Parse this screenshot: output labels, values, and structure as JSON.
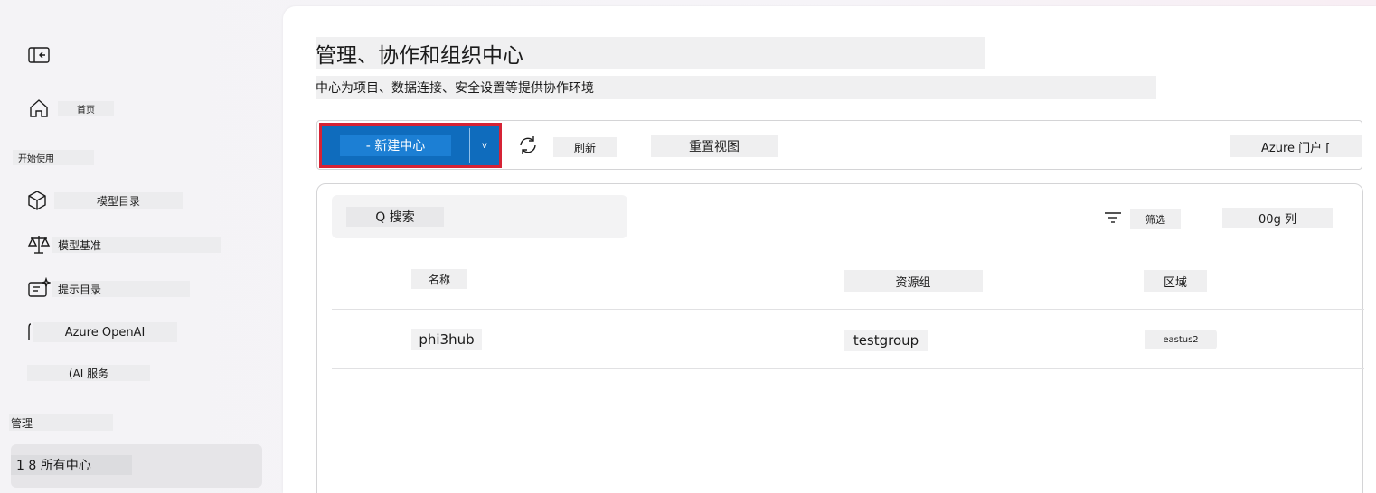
{
  "sidebar": {
    "items": [
      {
        "label": "首页",
        "icon": "home-icon"
      },
      {
        "label": "开始使用"
      },
      {
        "label": "模型目录",
        "icon": "cube-icon"
      },
      {
        "label": "模型基准",
        "icon": "scale-icon"
      },
      {
        "label": "提示目录",
        "icon": "prompt-catalog-icon"
      },
      {
        "label": "Azure OpenAI",
        "icon": "openai-icon"
      },
      {
        "label": "(AI 服务"
      }
    ],
    "section_manage": "管理",
    "active_item": "1 8 所有中心",
    "collapse_icon": "collapse-panel-icon"
  },
  "main": {
    "title": "管理、协作和组织中心",
    "subtitle": "中心为项目、数据连接、安全设置等提供协作环境",
    "toolbar": {
      "new_hub": "- 新建中心",
      "caret": "v",
      "refresh": "刷新",
      "reset_view": "重置视图",
      "azure_portal": "Azure 门户 ["
    },
    "search_placeholder": "Q 搜索",
    "filter": "筛选",
    "columns_btn": "00g 列",
    "table": {
      "headers": [
        "名称",
        "资源组",
        "区域"
      ],
      "rows": [
        {
          "name": "phi3hub",
          "resource_group": "testgroup",
          "region": "eastus2"
        }
      ]
    }
  },
  "colors": {
    "accent": "#0f6cbd",
    "highlight": "#d62335"
  }
}
